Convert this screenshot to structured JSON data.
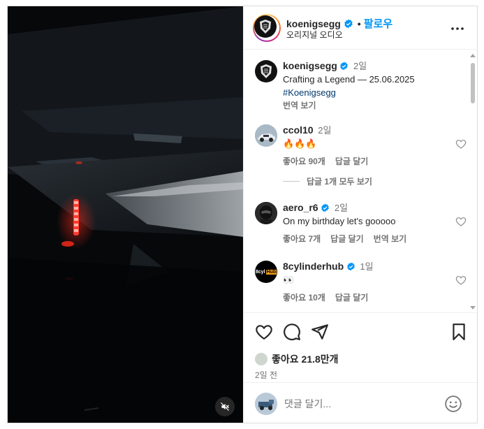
{
  "post": {
    "author": "koenigsegg",
    "audio_label": "오리지널 오디오",
    "follow_label": "팔로우",
    "separator": "•",
    "caption": {
      "username": "koenigsegg",
      "time": "2일",
      "text": "Crafting a Legend — 25.06.2025",
      "hashtag": "#Koenigsegg",
      "translate": "번역 보기"
    }
  },
  "comments": [
    {
      "username": "ccol10",
      "verified": false,
      "time": "2일",
      "text": "🔥🔥🔥",
      "likes": "좋아요 90개",
      "reply": "답글 달기",
      "translate": "",
      "avatar": "car-thumbnail"
    },
    {
      "username": "aero_r6",
      "verified": true,
      "time": "2일",
      "text": "On my birthday let's gooooo",
      "likes": "좋아요 7개",
      "reply": "답글 달기",
      "translate": "번역 보기",
      "avatar": "helmet"
    },
    {
      "username": "8cylinderhub",
      "verified": true,
      "time": "1일",
      "text": "👀",
      "likes": "좋아요 10개",
      "reply": "답글 달기",
      "translate": "",
      "avatar": "8cyl-hub-logo",
      "avatar_text": "8cyl",
      "avatar_badge": "Hub"
    }
  ],
  "replies_toggle": "답글 1개 모두 보기",
  "actions": {
    "likes": "좋아요 21.8만개",
    "date": "2일 전",
    "comment_placeholder": "댓글 달기..."
  },
  "icons": {
    "media_mute": "speaker-muted-icon",
    "more": "more-horizontal-icon",
    "like": "heart-icon",
    "comment": "comment-bubble-icon",
    "share": "paper-plane-icon",
    "save": "bookmark-icon",
    "emoji": "emoji-smile-icon",
    "verified": "verified-badge-icon"
  },
  "colors": {
    "follow": "#0095f6",
    "verified": "#0095f6",
    "hashtag": "#00376b",
    "muted_text": "#737373",
    "led_red": "#ff3b2e"
  }
}
